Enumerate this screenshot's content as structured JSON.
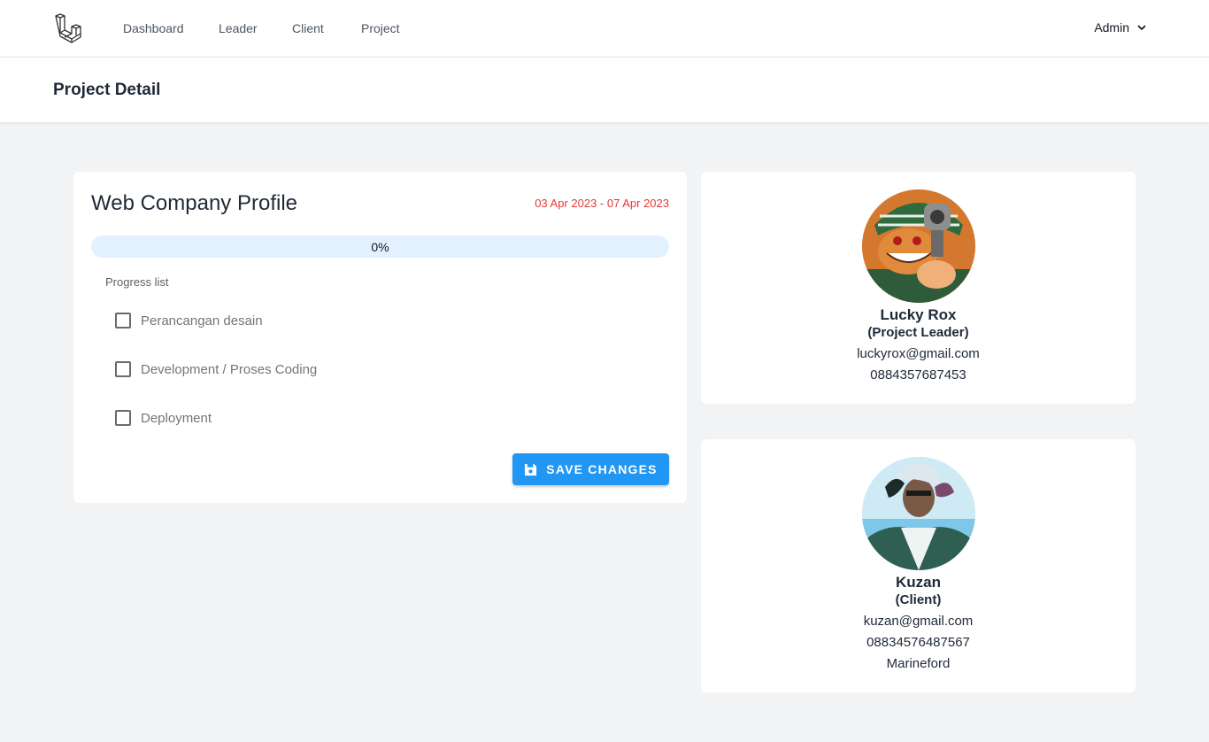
{
  "nav": {
    "logo_icon": "laravel-logo-icon",
    "links": [
      "Dashboard",
      "Leader",
      "Client",
      "Project"
    ],
    "user": "Admin"
  },
  "header": {
    "title": "Project Detail"
  },
  "project": {
    "name": "Web Company Profile",
    "dates": "03 Apr 2023 - 07 Apr 2023",
    "progress_text": "0%",
    "progress_value": 0,
    "progress_label": "Progress list",
    "tasks": [
      {
        "label": "Perancangan desain",
        "checked": false
      },
      {
        "label": "Development / Proses Coding",
        "checked": false
      },
      {
        "label": "Deployment",
        "checked": false
      }
    ],
    "save_label": "SAVE CHANGES"
  },
  "leader": {
    "name": "Lucky Rox",
    "role": "(Project Leader)",
    "email": "luckyrox@gmail.com",
    "phone": "0884357687453"
  },
  "client": {
    "name": "Kuzan",
    "role": "(Client)",
    "email": "kuzan@gmail.com",
    "phone": "08834576487567",
    "address": "Marineford"
  },
  "colors": {
    "accent": "#2196f3",
    "date": "#e53935",
    "progress_track": "#e3f0fd",
    "background": "#f2f3f5"
  }
}
